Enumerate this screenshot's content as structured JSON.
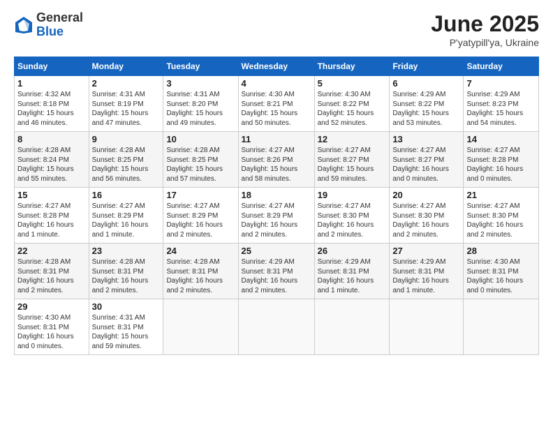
{
  "header": {
    "logo_general": "General",
    "logo_blue": "Blue",
    "month_title": "June 2025",
    "location": "P'yatypill'ya, Ukraine"
  },
  "days_of_week": [
    "Sunday",
    "Monday",
    "Tuesday",
    "Wednesday",
    "Thursday",
    "Friday",
    "Saturday"
  ],
  "weeks": [
    [
      {
        "day": "1",
        "info": "Sunrise: 4:32 AM\nSunset: 8:18 PM\nDaylight: 15 hours\nand 46 minutes."
      },
      {
        "day": "2",
        "info": "Sunrise: 4:31 AM\nSunset: 8:19 PM\nDaylight: 15 hours\nand 47 minutes."
      },
      {
        "day": "3",
        "info": "Sunrise: 4:31 AM\nSunset: 8:20 PM\nDaylight: 15 hours\nand 49 minutes."
      },
      {
        "day": "4",
        "info": "Sunrise: 4:30 AM\nSunset: 8:21 PM\nDaylight: 15 hours\nand 50 minutes."
      },
      {
        "day": "5",
        "info": "Sunrise: 4:30 AM\nSunset: 8:22 PM\nDaylight: 15 hours\nand 52 minutes."
      },
      {
        "day": "6",
        "info": "Sunrise: 4:29 AM\nSunset: 8:22 PM\nDaylight: 15 hours\nand 53 minutes."
      },
      {
        "day": "7",
        "info": "Sunrise: 4:29 AM\nSunset: 8:23 PM\nDaylight: 15 hours\nand 54 minutes."
      }
    ],
    [
      {
        "day": "8",
        "info": "Sunrise: 4:28 AM\nSunset: 8:24 PM\nDaylight: 15 hours\nand 55 minutes."
      },
      {
        "day": "9",
        "info": "Sunrise: 4:28 AM\nSunset: 8:25 PM\nDaylight: 15 hours\nand 56 minutes."
      },
      {
        "day": "10",
        "info": "Sunrise: 4:28 AM\nSunset: 8:25 PM\nDaylight: 15 hours\nand 57 minutes."
      },
      {
        "day": "11",
        "info": "Sunrise: 4:27 AM\nSunset: 8:26 PM\nDaylight: 15 hours\nand 58 minutes."
      },
      {
        "day": "12",
        "info": "Sunrise: 4:27 AM\nSunset: 8:27 PM\nDaylight: 15 hours\nand 59 minutes."
      },
      {
        "day": "13",
        "info": "Sunrise: 4:27 AM\nSunset: 8:27 PM\nDaylight: 16 hours\nand 0 minutes."
      },
      {
        "day": "14",
        "info": "Sunrise: 4:27 AM\nSunset: 8:28 PM\nDaylight: 16 hours\nand 0 minutes."
      }
    ],
    [
      {
        "day": "15",
        "info": "Sunrise: 4:27 AM\nSunset: 8:28 PM\nDaylight: 16 hours\nand 1 minute."
      },
      {
        "day": "16",
        "info": "Sunrise: 4:27 AM\nSunset: 8:29 PM\nDaylight: 16 hours\nand 1 minute."
      },
      {
        "day": "17",
        "info": "Sunrise: 4:27 AM\nSunset: 8:29 PM\nDaylight: 16 hours\nand 2 minutes."
      },
      {
        "day": "18",
        "info": "Sunrise: 4:27 AM\nSunset: 8:29 PM\nDaylight: 16 hours\nand 2 minutes."
      },
      {
        "day": "19",
        "info": "Sunrise: 4:27 AM\nSunset: 8:30 PM\nDaylight: 16 hours\nand 2 minutes."
      },
      {
        "day": "20",
        "info": "Sunrise: 4:27 AM\nSunset: 8:30 PM\nDaylight: 16 hours\nand 2 minutes."
      },
      {
        "day": "21",
        "info": "Sunrise: 4:27 AM\nSunset: 8:30 PM\nDaylight: 16 hours\nand 2 minutes."
      }
    ],
    [
      {
        "day": "22",
        "info": "Sunrise: 4:28 AM\nSunset: 8:31 PM\nDaylight: 16 hours\nand 2 minutes."
      },
      {
        "day": "23",
        "info": "Sunrise: 4:28 AM\nSunset: 8:31 PM\nDaylight: 16 hours\nand 2 minutes."
      },
      {
        "day": "24",
        "info": "Sunrise: 4:28 AM\nSunset: 8:31 PM\nDaylight: 16 hours\nand 2 minutes."
      },
      {
        "day": "25",
        "info": "Sunrise: 4:29 AM\nSunset: 8:31 PM\nDaylight: 16 hours\nand 2 minutes."
      },
      {
        "day": "26",
        "info": "Sunrise: 4:29 AM\nSunset: 8:31 PM\nDaylight: 16 hours\nand 1 minute."
      },
      {
        "day": "27",
        "info": "Sunrise: 4:29 AM\nSunset: 8:31 PM\nDaylight: 16 hours\nand 1 minute."
      },
      {
        "day": "28",
        "info": "Sunrise: 4:30 AM\nSunset: 8:31 PM\nDaylight: 16 hours\nand 0 minutes."
      }
    ],
    [
      {
        "day": "29",
        "info": "Sunrise: 4:30 AM\nSunset: 8:31 PM\nDaylight: 16 hours\nand 0 minutes."
      },
      {
        "day": "30",
        "info": "Sunrise: 4:31 AM\nSunset: 8:31 PM\nDaylight: 15 hours\nand 59 minutes."
      },
      null,
      null,
      null,
      null,
      null
    ]
  ]
}
